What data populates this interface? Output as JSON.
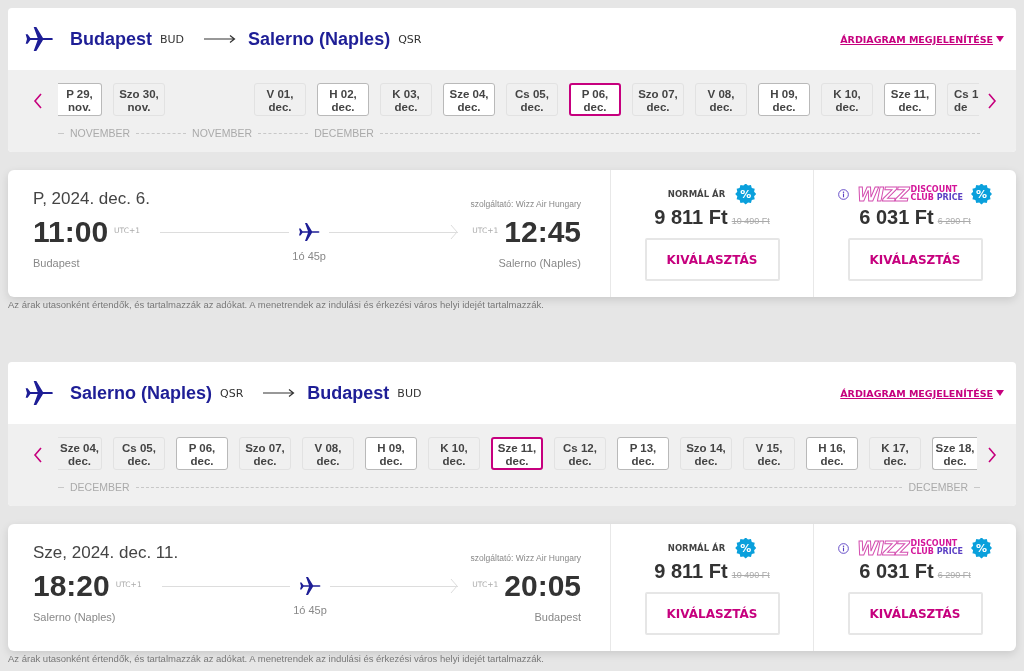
{
  "sections": [
    {
      "route": {
        "from_city": "Budapest",
        "from_code": "BUD",
        "to_city": "Salerno (Naples)",
        "to_code": "QSR"
      },
      "chart_link": "ÁRDIAGRAM MEGJELENÍTÉSE",
      "dates": [
        {
          "kind": "cut_left",
          "day": "P 29,",
          "month": "nov.",
          "available": true,
          "selected": false
        },
        {
          "kind": "date",
          "day": "Szo 30,",
          "month": "nov.",
          "available": false,
          "selected": false
        },
        {
          "kind": "gap"
        },
        {
          "kind": "date",
          "day": "V 01,",
          "month": "dec.",
          "available": false,
          "selected": false
        },
        {
          "kind": "date",
          "day": "H 02,",
          "month": "dec.",
          "available": true,
          "selected": false
        },
        {
          "kind": "date",
          "day": "K 03,",
          "month": "dec.",
          "available": false,
          "selected": false
        },
        {
          "kind": "date",
          "day": "Sze 04,",
          "month": "dec.",
          "available": true,
          "selected": false
        },
        {
          "kind": "date",
          "day": "Cs 05,",
          "month": "dec.",
          "available": false,
          "selected": false
        },
        {
          "kind": "date",
          "day": "P 06,",
          "month": "dec.",
          "available": true,
          "selected": true
        },
        {
          "kind": "date",
          "day": "Szo 07,",
          "month": "dec.",
          "available": false,
          "selected": false
        },
        {
          "kind": "date",
          "day": "V 08,",
          "month": "dec.",
          "available": false,
          "selected": false
        },
        {
          "kind": "date",
          "day": "H 09,",
          "month": "dec.",
          "available": true,
          "selected": false
        },
        {
          "kind": "date",
          "day": "K 10,",
          "month": "dec.",
          "available": false,
          "selected": false
        },
        {
          "kind": "date",
          "day": "Sze 11,",
          "month": "dec.",
          "available": true,
          "selected": false
        },
        {
          "kind": "cut_right",
          "day": "Cs 1",
          "month": "de",
          "available": false,
          "selected": false
        }
      ],
      "months": [
        "NOVEMBER",
        "NOVEMBER",
        "DECEMBER"
      ],
      "flight": {
        "date": "P, 2024. dec. 6.",
        "operator": "szolgáltató: Wizz Air Hungary",
        "dep_time": "11:00",
        "dep_tz": "UTC+1",
        "arr_tz": "UTC+1",
        "arr_time": "12:45",
        "duration": "1ó 45p",
        "dep_city": "Budapest",
        "arr_city": "Salerno (Naples)"
      },
      "fares": [
        {
          "kind": "normal",
          "label": "NORMÁL ÁR",
          "badge": "%",
          "price": "9 811 Ft",
          "old_price": "10 490 Ft",
          "button": "KIVÁLASZTÁS"
        },
        {
          "kind": "club",
          "logo_mark": "WIZZ",
          "logo_top": "DISCOUNT",
          "logo_left": "CLUB",
          "logo_right": "PRICE",
          "badge": "%",
          "price": "6 031 Ft",
          "old_price": "6 290 Ft",
          "button": "KIVÁLASZTÁS"
        }
      ],
      "disclaimer": "Az árak utasonként értendők, és tartalmazzák az adókat. A menetrendek az indulási és érkezési város helyi idejét tartalmazzák."
    },
    {
      "route": {
        "from_city": "Salerno (Naples)",
        "from_code": "QSR",
        "to_city": "Budapest",
        "to_code": "BUD"
      },
      "chart_link": "ÁRDIAGRAM MEGJELENÍTÉSE",
      "dates": [
        {
          "kind": "cut_left",
          "day": "Sze 04,",
          "month": "dec.",
          "available": false,
          "selected": false
        },
        {
          "kind": "date",
          "day": "Cs 05,",
          "month": "dec.",
          "available": false,
          "selected": false
        },
        {
          "kind": "date",
          "day": "P 06,",
          "month": "dec.",
          "available": true,
          "selected": false
        },
        {
          "kind": "date",
          "day": "Szo 07,",
          "month": "dec.",
          "available": false,
          "selected": false
        },
        {
          "kind": "date",
          "day": "V 08,",
          "month": "dec.",
          "available": false,
          "selected": false
        },
        {
          "kind": "date",
          "day": "H 09,",
          "month": "dec.",
          "available": true,
          "selected": false
        },
        {
          "kind": "date",
          "day": "K 10,",
          "month": "dec.",
          "available": false,
          "selected": false
        },
        {
          "kind": "date",
          "day": "Sze 11,",
          "month": "dec.",
          "available": true,
          "selected": true
        },
        {
          "kind": "date",
          "day": "Cs 12,",
          "month": "dec.",
          "available": false,
          "selected": false
        },
        {
          "kind": "date",
          "day": "P 13,",
          "month": "dec.",
          "available": true,
          "selected": false
        },
        {
          "kind": "date",
          "day": "Szo 14,",
          "month": "dec.",
          "available": false,
          "selected": false
        },
        {
          "kind": "date",
          "day": "V 15,",
          "month": "dec.",
          "available": false,
          "selected": false
        },
        {
          "kind": "date",
          "day": "H 16,",
          "month": "dec.",
          "available": true,
          "selected": false
        },
        {
          "kind": "date",
          "day": "K 17,",
          "month": "dec.",
          "available": false,
          "selected": false
        },
        {
          "kind": "cut_right",
          "day": "Sze 18,",
          "month": "dec.",
          "available": true,
          "selected": false
        }
      ],
      "months": [
        "DECEMBER",
        "DECEMBER"
      ],
      "flight": {
        "date": "Sze, 2024. dec. 11.",
        "operator": "szolgáltató: Wizz Air Hungary",
        "dep_time": "18:20",
        "dep_tz": "UTC+1",
        "arr_tz": "UTC+1",
        "arr_time": "20:05",
        "duration": "1ó 45p",
        "dep_city": "Salerno (Naples)",
        "arr_city": "Budapest"
      },
      "fares": [
        {
          "kind": "normal",
          "label": "NORMÁL ÁR",
          "badge": "%",
          "price": "9 811 Ft",
          "old_price": "10 490 Ft",
          "button": "KIVÁLASZTÁS"
        },
        {
          "kind": "club",
          "logo_mark": "WIZZ",
          "logo_top": "DISCOUNT",
          "logo_left": "CLUB",
          "logo_right": "PRICE",
          "badge": "%",
          "price": "6 031 Ft",
          "old_price": "6 290 Ft",
          "button": "KIVÁLASZTÁS"
        }
      ],
      "disclaimer": "Az árak utasonként értendők, és tartalmazzák az adókat. A menetrendek az indulási és érkezési város helyi idejét tartalmazzák."
    }
  ]
}
